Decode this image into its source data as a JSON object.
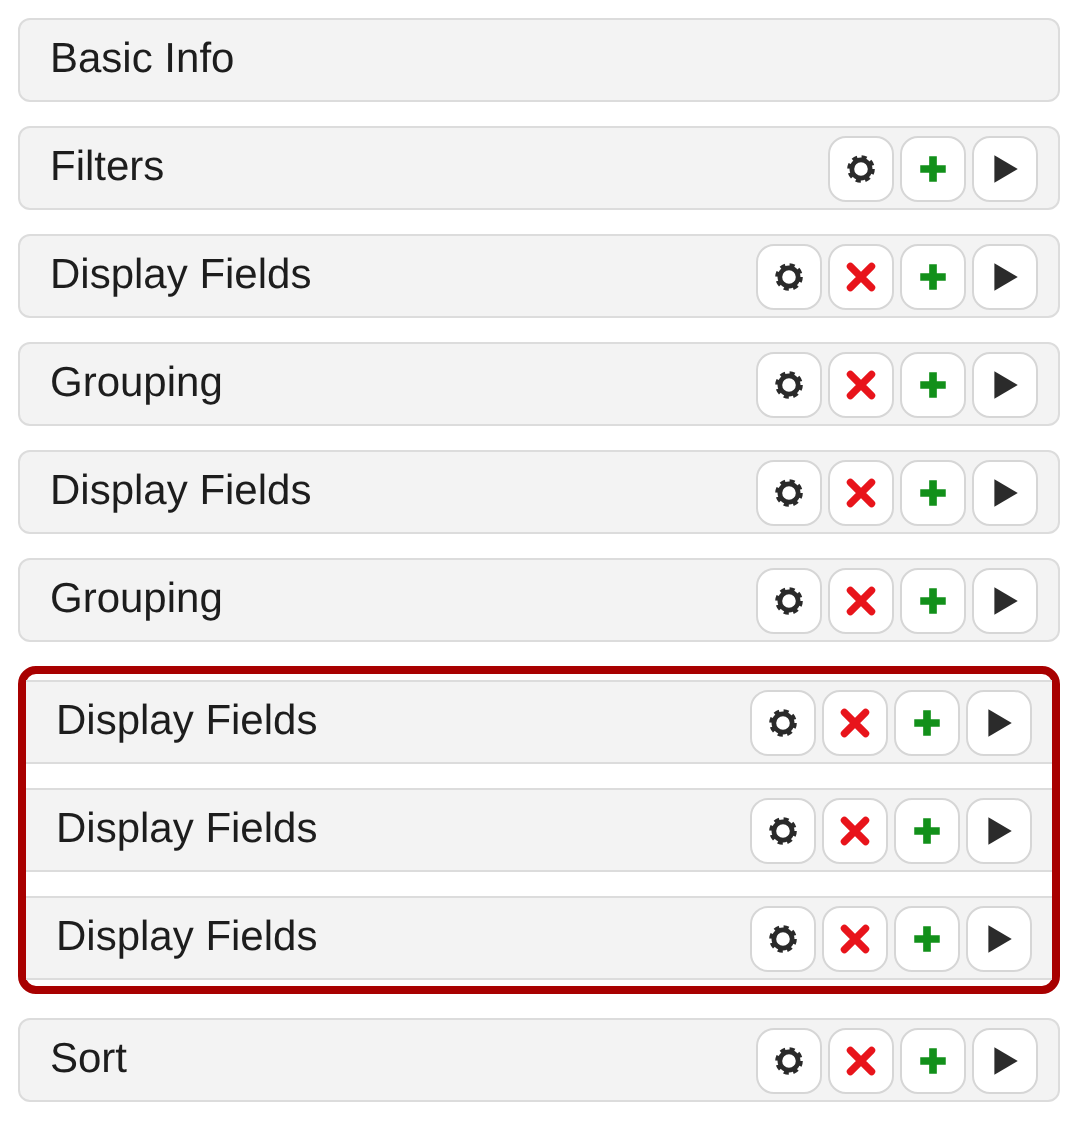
{
  "sections": [
    {
      "kind": "row",
      "label": "Basic Info"
    },
    {
      "kind": "row",
      "label": "Filters",
      "actions": [
        {
          "kind": "settings"
        },
        {
          "kind": "add"
        },
        {
          "kind": "expand"
        }
      ]
    },
    {
      "kind": "row",
      "label": "Display Fields",
      "actions": [
        {
          "kind": "settings"
        },
        {
          "kind": "delete"
        },
        {
          "kind": "add"
        },
        {
          "kind": "expand"
        }
      ]
    },
    {
      "kind": "row",
      "label": "Grouping",
      "actions": [
        {
          "kind": "settings"
        },
        {
          "kind": "delete"
        },
        {
          "kind": "add"
        },
        {
          "kind": "expand"
        }
      ]
    },
    {
      "kind": "row",
      "label": "Display Fields",
      "actions": [
        {
          "kind": "settings"
        },
        {
          "kind": "delete"
        },
        {
          "kind": "add"
        },
        {
          "kind": "expand"
        }
      ]
    },
    {
      "kind": "row",
      "label": "Grouping",
      "actions": [
        {
          "kind": "settings"
        },
        {
          "kind": "delete"
        },
        {
          "kind": "add"
        },
        {
          "kind": "expand"
        }
      ]
    },
    {
      "kind": "group",
      "rows": [
        {
          "label": "Display Fields",
          "actions": [
            {
              "kind": "settings"
            },
            {
              "kind": "delete"
            },
            {
              "kind": "add"
            },
            {
              "kind": "expand"
            }
          ]
        },
        {
          "label": "Display Fields",
          "actions": [
            {
              "kind": "settings"
            },
            {
              "kind": "delete"
            },
            {
              "kind": "add"
            },
            {
              "kind": "expand"
            }
          ]
        },
        {
          "label": "Display Fields",
          "actions": [
            {
              "kind": "settings"
            },
            {
              "kind": "delete"
            },
            {
              "kind": "add"
            },
            {
              "kind": "expand"
            }
          ]
        }
      ]
    },
    {
      "kind": "row",
      "label": "Sort",
      "actions": [
        {
          "kind": "settings"
        },
        {
          "kind": "delete"
        },
        {
          "kind": "add"
        },
        {
          "kind": "expand"
        }
      ]
    }
  ]
}
